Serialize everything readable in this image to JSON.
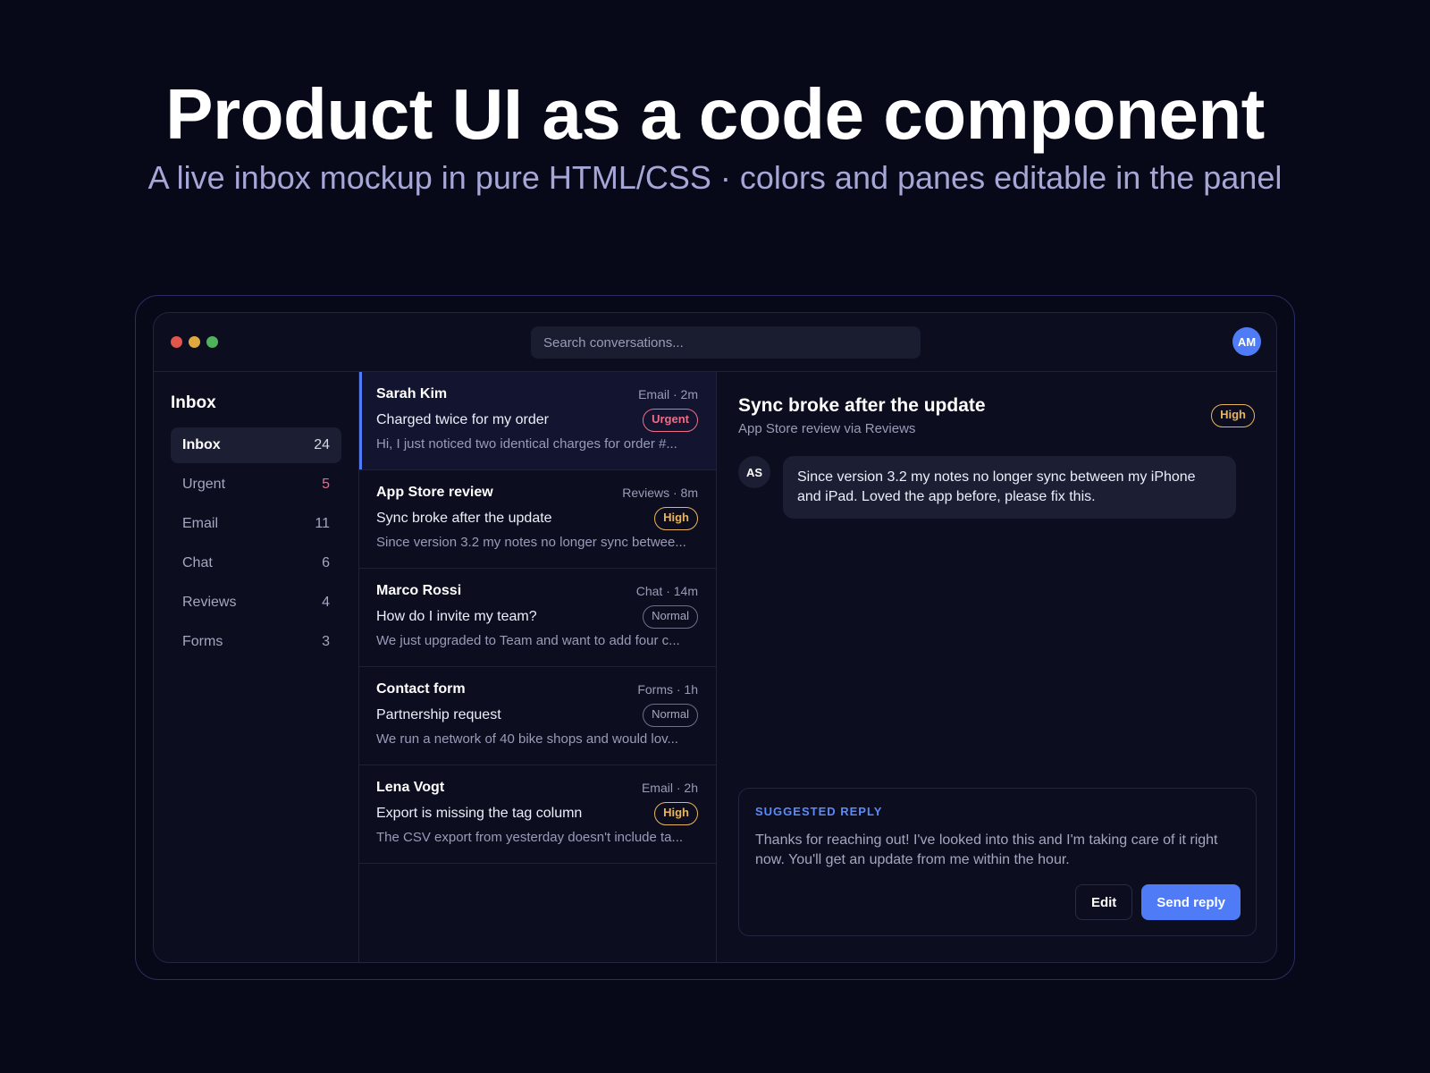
{
  "hero": {
    "title": "Product UI as a code component",
    "subtitle": "A live inbox mockup in pure HTML/CSS · colors and panes editable in the panel"
  },
  "topbar": {
    "search_placeholder": "Search conversations...",
    "avatar_initials": "AM",
    "window_dots": [
      "close",
      "minimize",
      "maximize"
    ]
  },
  "sidebar": {
    "heading": "Inbox",
    "items": [
      {
        "label": "Inbox",
        "count": "24",
        "active": true
      },
      {
        "label": "Urgent",
        "count": "5",
        "highlight": true
      },
      {
        "label": "Email",
        "count": "11"
      },
      {
        "label": "Chat",
        "count": "6"
      },
      {
        "label": "Reviews",
        "count": "4"
      },
      {
        "label": "Forms",
        "count": "3"
      }
    ]
  },
  "conversations": [
    {
      "sender": "Sarah Kim",
      "meta": "Email · 2m",
      "subject": "Charged twice for my order",
      "badge": "Urgent",
      "preview": "Hi, I just noticed two identical charges for order #...",
      "selected": true
    },
    {
      "sender": "App Store review",
      "meta": "Reviews · 8m",
      "subject": "Sync broke after the update",
      "badge": "High",
      "preview": "Since version 3.2 my notes no longer sync betwee..."
    },
    {
      "sender": "Marco Rossi",
      "meta": "Chat · 14m",
      "subject": "How do I invite my team?",
      "badge": "Normal",
      "preview": "We just upgraded to Team and want to add four c..."
    },
    {
      "sender": "Contact form",
      "meta": "Forms · 1h",
      "subject": "Partnership request",
      "badge": "Normal",
      "preview": "We run a network of 40 bike shops and would lov..."
    },
    {
      "sender": "Lena Vogt",
      "meta": "Email · 2h",
      "subject": "Export is missing the tag column",
      "badge": "High",
      "preview": "The CSV export from yesterday doesn't include ta..."
    }
  ],
  "detail": {
    "title": "Sync broke after the update",
    "source": "App Store review via Reviews",
    "badge": "High",
    "message_avatar": "AS",
    "message": "Since version 3.2 my notes no longer sync between my iPhone and iPad. Loved the app before, please fix this.",
    "suggested_label": "SUGGESTED REPLY",
    "suggested_text": "Thanks for reaching out! I've looked into this and I'm taking care of it right now. You'll get an update from me within the hour.",
    "edit_label": "Edit",
    "send_label": "Send reply"
  },
  "colors": {
    "accent": "#4f7cf6",
    "urgent": "#ef6e86",
    "high": "#e9b55c",
    "background": "#070818"
  }
}
